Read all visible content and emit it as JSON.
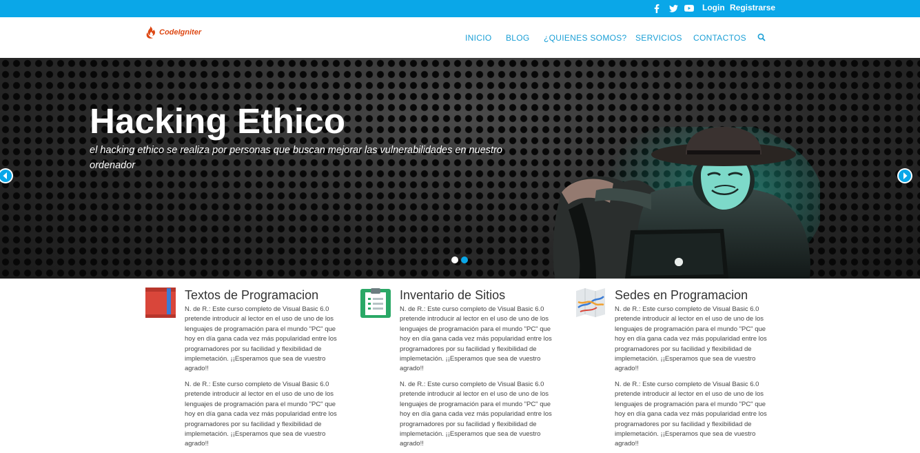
{
  "topbar": {
    "social": [
      {
        "name": "facebook-icon"
      },
      {
        "name": "twitter-icon"
      },
      {
        "name": "youtube-icon"
      }
    ],
    "login": "Login",
    "register": "Registrarse"
  },
  "header": {
    "logo_text": "CodeIgniter",
    "nav": [
      "INICIO",
      "BLOG",
      "¿QUIENES SOMOS?",
      "SERVICIOS",
      "CONTACTOS"
    ],
    "search_icon": "search-icon"
  },
  "hero": {
    "title": "Hacking Ethico",
    "subtitle": "el hacking ethico se realiza por personas que buscan mejorar las vulnerabilidades en nuestro ordenador",
    "slides": 2,
    "active_slide": 1
  },
  "features": [
    {
      "icon": "book-icon",
      "title": "Textos de Programacion",
      "p1": "N. de R.: Este curso completo de Visual Basic 6.0 pretende introducir al lector en el uso de uno de los lenguajes de programación para el mundo \"PC\" que hoy en día gana cada vez más popularidad entre los programadores por su facilidad y flexibilidad de implemetación. ¡¡Esperamos que sea de vuestro agrado!!",
      "p2": "N. de R.: Este curso completo de Visual Basic 6.0 pretende introducir al lector en el uso de uno de los lenguajes de programación para el mundo \"PC\" que hoy en día gana cada vez más popularidad entre los programadores por su facilidad y flexibilidad de implemetación. ¡¡Esperamos que sea de vuestro agrado!!"
    },
    {
      "icon": "clipboard-icon",
      "title": "Inventario de Sitios",
      "p1": "N. de R.: Este curso completo de Visual Basic 6.0 pretende introducir al lector en el uso de uno de los lenguajes de programación para el mundo \"PC\" que hoy en día gana cada vez más popularidad entre los programadores por su facilidad y flexibilidad de implemetación. ¡¡Esperamos que sea de vuestro agrado!!",
      "p2": "N. de R.: Este curso completo de Visual Basic 6.0 pretende introducir al lector en el uso de uno de los lenguajes de programación para el mundo \"PC\" que hoy en día gana cada vez más popularidad entre los programadores por su facilidad y flexibilidad de implemetación. ¡¡Esperamos que sea de vuestro agrado!!"
    },
    {
      "icon": "map-icon",
      "title": "Sedes en Programacion",
      "p1": "N. de R.: Este curso completo de Visual Basic 6.0 pretende introducir al lector en el uso de uno de los lenguajes de programación para el mundo \"PC\" que hoy en día gana cada vez más popularidad entre los programadores por su facilidad y flexibilidad de implemetación. ¡¡Esperamos que sea de vuestro agrado!!",
      "p2": "N. de R.: Este curso completo de Visual Basic 6.0 pretende introducir al lector en el uso de uno de los lenguajes de programación para el mundo \"PC\" que hoy en día gana cada vez más popularidad entre los programadores por su facilidad y flexibilidad de implemetación. ¡¡Esperamos que sea de vuestro agrado!!"
    }
  ],
  "colors": {
    "topbar": "#0aa7e8",
    "nav_link": "#1a9fd6",
    "logo": "#dd4814"
  }
}
